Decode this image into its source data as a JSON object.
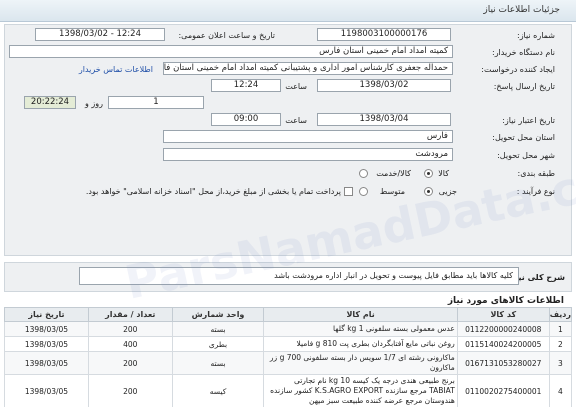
{
  "header": {
    "title": "جزئیات اطلاعات نیاز"
  },
  "form": {
    "need_number_label": "شماره نیاز:",
    "need_number": "1198003100000176",
    "announce_label": "تاریخ و ساعت اعلان عمومی:",
    "announce_value": "1398/03/02 - 12:24",
    "buyer_label": "نام دستگاه خریدار:",
    "buyer_value": "کمیته امداد امام خمینی استان فارس",
    "creator_label": "ایجاد کننده درخواست:",
    "creator_value": "حمداله جعفری کارشناس امور اداری و پشتیبانی کمیته امداد امام خمینی استان فارس",
    "contact_link": "اطلاعات تماس خریدار",
    "reply_date_label": "تاریخ ارسال پاسخ:",
    "reply_date": "1398/03/02",
    "time_label": "ساعت",
    "reply_time": "12:24",
    "days_label": "روز و",
    "days_value": "1",
    "remaining_time": "20:22:24",
    "remaining_label": "ساعت باقی مانده",
    "validity_label": "تاریخ اعتبار نیاز:",
    "validity_date": "1398/03/04",
    "validity_time": "09:00",
    "province_label": "استان محل تحویل:",
    "province_value": "فارس",
    "city_label": "شهر محل تحویل:",
    "city_value": "مرودشت",
    "type_label": "طبقه بندی:",
    "type_goods": "کالا",
    "type_service": "کالا/خدمت",
    "process_label": "نوع فرآیند :",
    "process_partial": "جزیی",
    "process_medium": "متوسط",
    "payment_text": "پرداخت تمام یا بخشی از مبلغ خرید،از محل \"اسناد خزانه اسلامی\" خواهد بود."
  },
  "description": {
    "label": "شرح کلی نیاز:",
    "text": "کلیه کالاها باید مطابق فایل پیوست و تحویل در انبار اداره مرودشت باشد"
  },
  "goods": {
    "title": "اطلاعات کالاهای مورد نیاز",
    "headers": [
      "ردیف",
      "کد کالا",
      "نام کالا",
      "واحد شمارش",
      "تعداد / مقدار",
      "تاریخ نیاز"
    ],
    "rows": [
      [
        "1",
        "0112200000240008",
        "عدس معمولی بسته سلفونی 1 kg گلها",
        "بسته",
        "200",
        "1398/03/05"
      ],
      [
        "2",
        "0115140024200005",
        "روغن نباتی مایع آفتابگردان بطری پت 810 g فامیلا",
        "بطری",
        "400",
        "1398/03/05"
      ],
      [
        "3",
        "0167131053280027",
        "ماکارونی رشته ای 1/7 سویس دار بسته سلفونی 700 g زر ماکارون",
        "بسته",
        "200",
        "1398/03/05"
      ],
      [
        "4",
        "0110020275400001",
        "برنج طبیعی هندی درجه یک کیسه 10 kg نام تجارتی TABIAT مرجع سازنده K.S.AGRO EXPORT کشور سازنده هندوستان مرجع عرضه کننده طبیعت سبز میهن",
        "کیسه",
        "200",
        "1398/03/05"
      ]
    ]
  },
  "watermark": "ParsNamadData.com"
}
